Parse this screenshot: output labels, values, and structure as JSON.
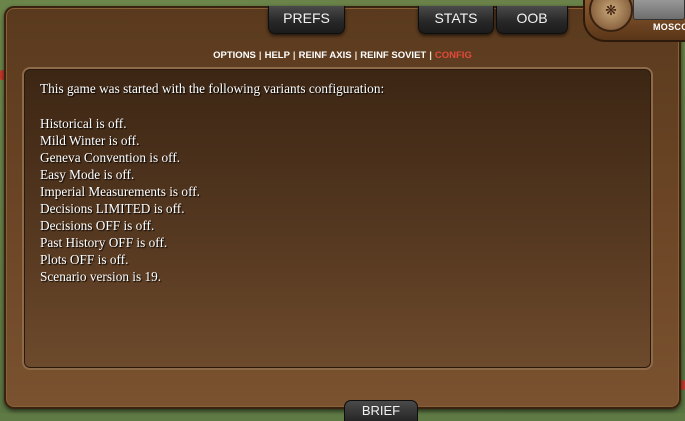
{
  "tabs": {
    "prefs": "PREFS",
    "stats": "STATS",
    "oob": "OOB",
    "brief": "BRIEF"
  },
  "emblem": {
    "label": "MOSCO"
  },
  "subnav": {
    "items": [
      "OPTIONS",
      "HELP",
      "REINF AXIS",
      "REINF SOVIET",
      "CONFIG"
    ],
    "separator": "|",
    "active": "CONFIG",
    "active_color": "#e24a3a"
  },
  "config": {
    "intro": "This game was started with the following variants configuration:",
    "variants": [
      "Historical is off.",
      "Mild Winter is off.",
      "Geneva Convention is off.",
      "Easy Mode is off.",
      "Imperial Measurements is off.",
      "Decisions LIMITED is off.",
      "Decisions OFF is off.",
      "Past History OFF is off.",
      "Plots OFF is off.",
      "Scenario version is 19."
    ]
  }
}
